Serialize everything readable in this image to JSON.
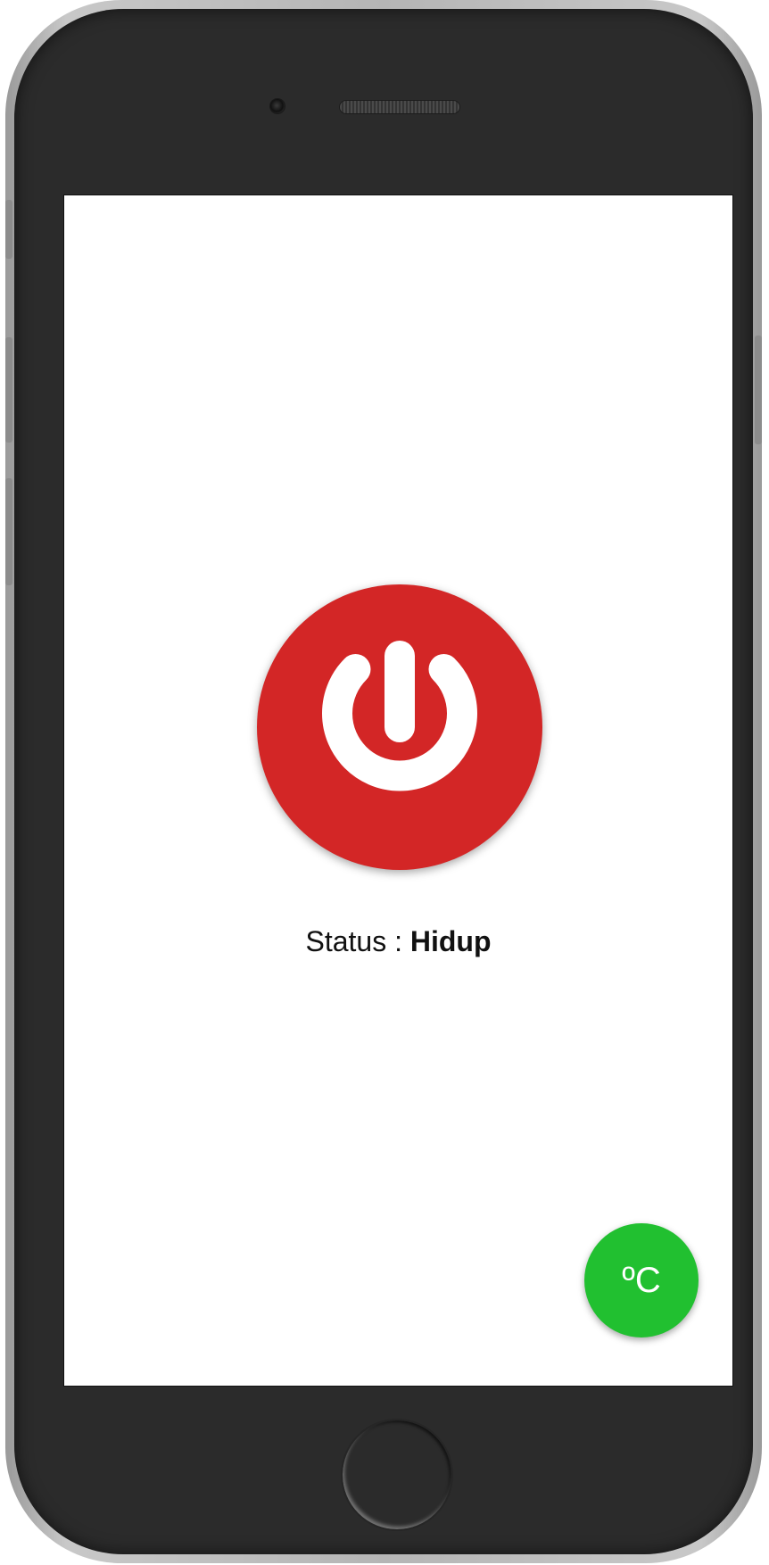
{
  "app": {
    "status_label": "Status :",
    "status_value": "Hidup"
  },
  "power_button": {
    "icon": "power-icon",
    "color": "#d32626"
  },
  "temperature_button": {
    "label": "ºC",
    "color": "#21c030"
  },
  "device": {
    "frame_color": "#2b2b2b"
  }
}
